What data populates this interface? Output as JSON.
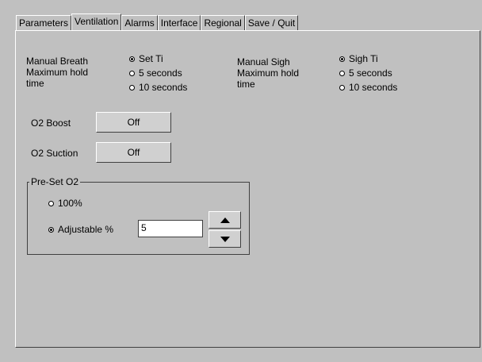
{
  "tabs": [
    "Parameters",
    "Ventilation",
    "Alarms",
    "Interface",
    "Regional",
    "Save / Quit"
  ],
  "manual_breath": {
    "label_line1": "Manual Breath",
    "label_line2": "Maximum hold",
    "label_line3": "time",
    "options": [
      "Set Ti",
      "5 seconds",
      "10 seconds"
    ],
    "selected": "Set Ti"
  },
  "manual_sigh": {
    "label_line1": "Manual Sigh",
    "label_line2": "Maximum hold",
    "label_line3": "time",
    "options": [
      "Sigh Ti",
      "5 seconds",
      "10 seconds"
    ],
    "selected": "Sigh Ti"
  },
  "o2_boost": {
    "label": "O2 Boost",
    "value": "Off"
  },
  "o2_suction": {
    "label": "O2 Suction",
    "value": "Off"
  },
  "preset_o2": {
    "title": "Pre-Set O2",
    "option_100": "100%",
    "option_adjustable": "Adjustable %",
    "selected": "Adjustable %",
    "adjustable_value": "5"
  }
}
